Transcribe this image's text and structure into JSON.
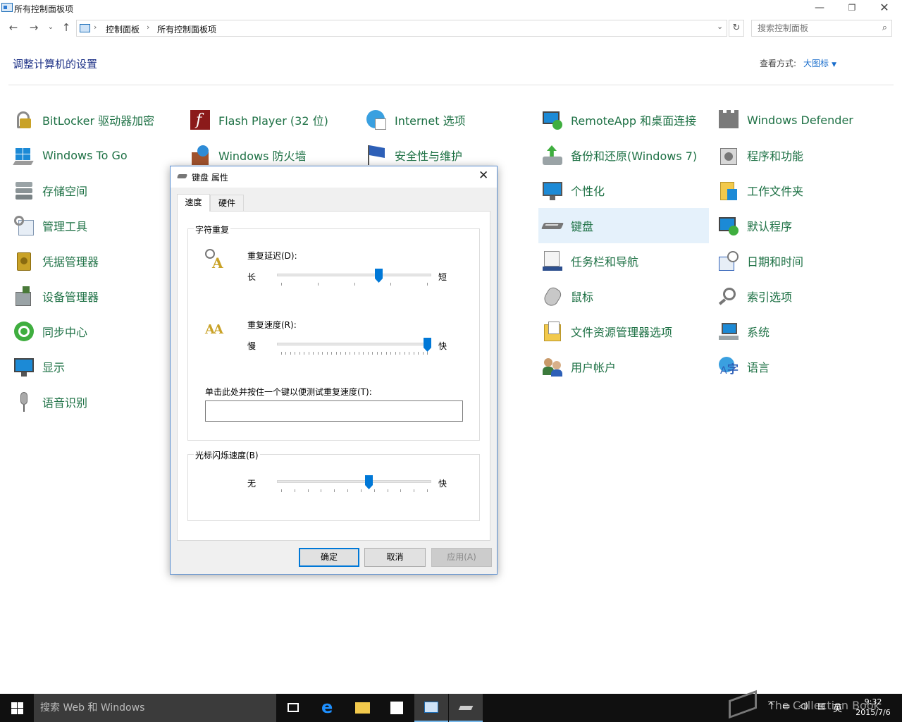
{
  "window": {
    "title": "所有控制面板项"
  },
  "address": {
    "crumbs": [
      "控制面板",
      "所有控制面板项"
    ],
    "search_placeholder": "搜索控制面板"
  },
  "page": {
    "heading": "调整计算机的设置",
    "view_by_label": "查看方式:",
    "view_by_value": "大图标"
  },
  "items": [
    "BitLocker 驱动器加密",
    "Windows To Go",
    "存储空间",
    "管理工具",
    "凭据管理器",
    "设备管理器",
    "同步中心",
    "显示",
    "语音识别",
    "Flash Player (32 位)",
    "Windows 防火墙",
    "Internet 选项",
    "安全性与维护",
    "RemoteApp 和桌面连接",
    "备份和还原(Windows 7)",
    "个性化",
    "键盘",
    "任务栏和导航",
    "鼠标",
    "文件资源管理器选项",
    "用户帐户",
    "Windows Defender",
    "程序和功能",
    "工作文件夹",
    "默认程序",
    "日期和时间",
    "索引选项",
    "系统",
    "语言"
  ],
  "dialog": {
    "title": "键盘 属性",
    "tabs": [
      "速度",
      "硬件"
    ],
    "char_repeat_group": "字符重复",
    "repeat_delay_label": "重复延迟(D):",
    "long": "长",
    "short": "短",
    "repeat_rate_label": "重复速度(R):",
    "slow": "慢",
    "fast": "快",
    "test_label": "单击此处并按住一个键以便测试重复速度(T):",
    "cursor_group": "光标闪烁速度(B)",
    "none": "无",
    "ok": "确定",
    "cancel": "取消",
    "apply": "应用(A)",
    "repeat_delay_level": 0.667,
    "repeat_rate_level": 1.0,
    "cursor_blink_level": 0.6
  },
  "taskbar": {
    "search_placeholder": "搜索 Web 和 Windows",
    "ime": "英",
    "time": "9:32",
    "date": "2015/7/6",
    "watermark": "The Collection Book"
  }
}
